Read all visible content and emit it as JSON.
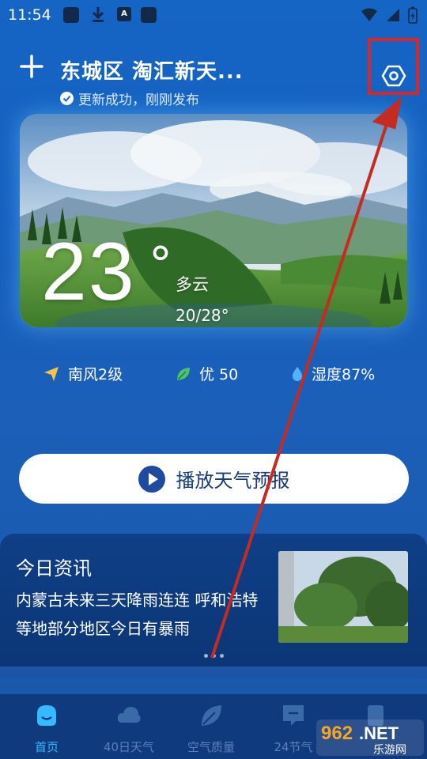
{
  "status_bar": {
    "time": "11:54",
    "a_icon_text": "A"
  },
  "header": {
    "location": "东城区 淘汇新天...",
    "update_status": "更新成功，刚刚发布"
  },
  "current": {
    "temperature": "23",
    "degree": "°",
    "condition": "多云",
    "range": "20/28°"
  },
  "stats": {
    "wind": "南风2级",
    "air_quality": "优 50",
    "humidity": "湿度87%"
  },
  "play_button": {
    "label": "播放天气预报"
  },
  "news": {
    "title": "今日资讯",
    "body": "内蒙古未来三天降雨连连 呼和浩特等地部分地区今日有暴雨"
  },
  "bottom_nav": [
    {
      "label": "首页",
      "active": true
    },
    {
      "label": "40日天气",
      "active": false
    },
    {
      "label": "空气质量",
      "active": false
    },
    {
      "label": "24节气",
      "active": false
    },
    {
      "label": "",
      "active": false
    }
  ],
  "watermark": {
    "brand": "962.NET",
    "sub": "乐游网"
  },
  "colors": {
    "highlight": "#d92626",
    "accent_blue": "#35b9ff",
    "nav_inactive": "#5c7fb8",
    "play_text": "#173a7a"
  }
}
